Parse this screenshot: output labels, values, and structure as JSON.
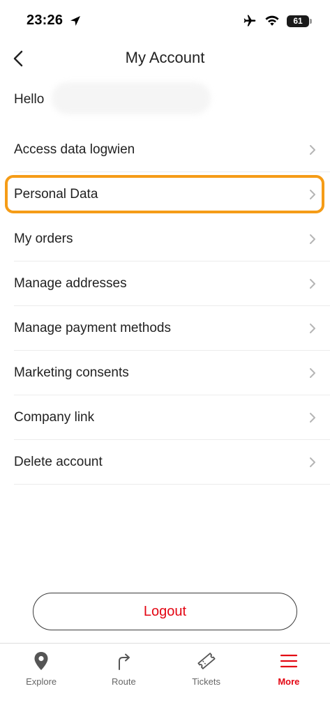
{
  "status_bar": {
    "time": "23:26",
    "battery": "61"
  },
  "header": {
    "title": "My Account"
  },
  "greeting": {
    "text": "Hello"
  },
  "menu": {
    "items": [
      {
        "label": "Access data logwien"
      },
      {
        "label": "Personal Data",
        "highlighted": true
      },
      {
        "label": "My orders"
      },
      {
        "label": "Manage addresses"
      },
      {
        "label": "Manage payment methods"
      },
      {
        "label": "Marketing consents"
      },
      {
        "label": "Company link"
      },
      {
        "label": "Delete account"
      }
    ]
  },
  "logout": {
    "label": "Logout"
  },
  "tabbar": {
    "tabs": [
      {
        "label": "Explore",
        "icon": "map-pin-icon"
      },
      {
        "label": "Route",
        "icon": "route-arrow-icon"
      },
      {
        "label": "Tickets",
        "icon": "ticket-icon"
      },
      {
        "label": "More",
        "icon": "menu-icon",
        "active": true
      }
    ]
  },
  "colors": {
    "accent": "#e30613",
    "highlight": "#f59c17",
    "text": "#222222",
    "divider": "#ececec"
  }
}
